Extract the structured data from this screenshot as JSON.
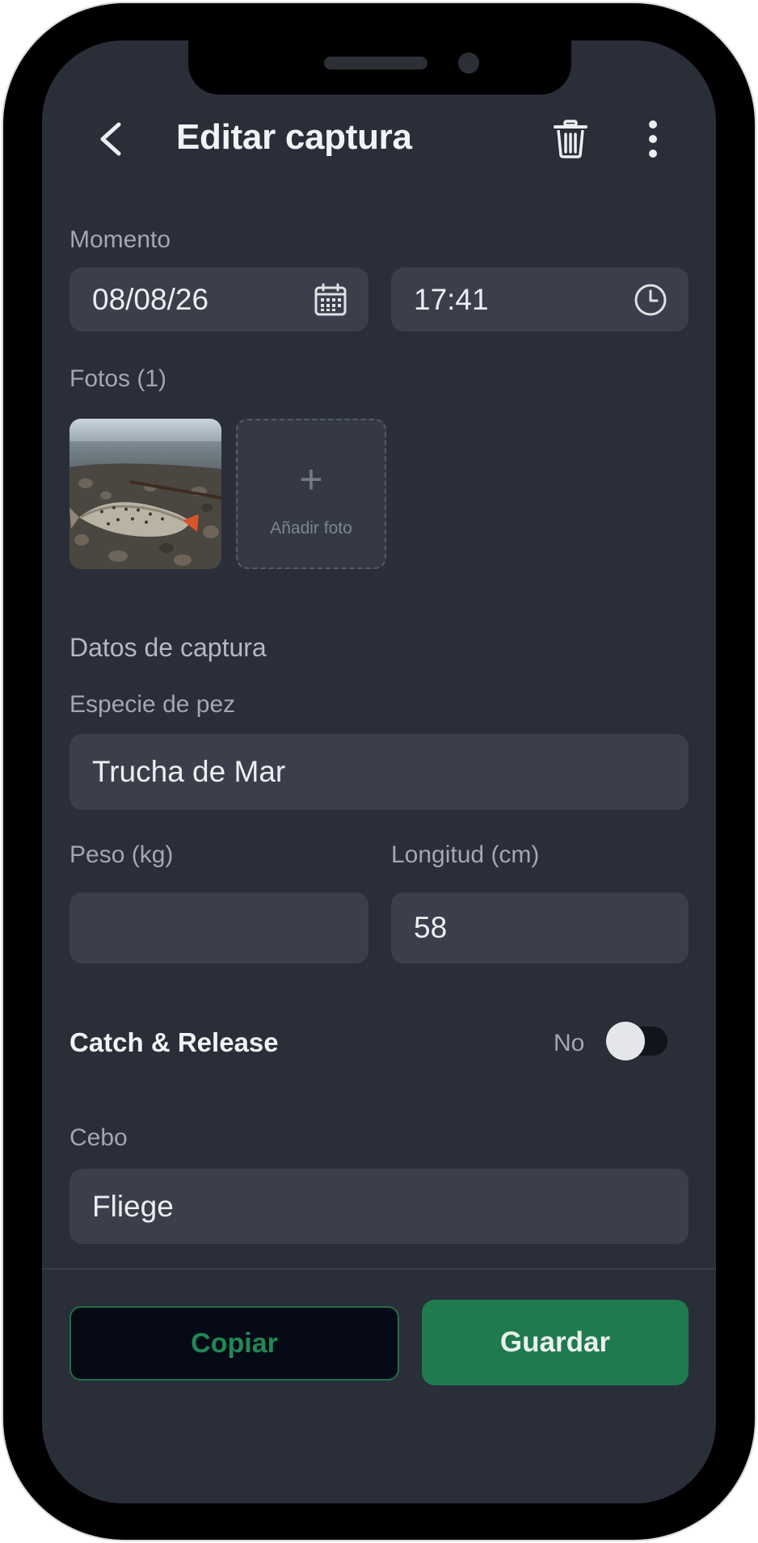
{
  "header": {
    "title": "Editar captura",
    "back_icon": "chevron-left-icon",
    "delete_icon": "trash-icon",
    "more_icon": "more-vertical-icon"
  },
  "moment": {
    "label": "Momento",
    "date": "08/08/26",
    "date_icon": "calendar-icon",
    "time": "17:41",
    "time_icon": "clock-icon"
  },
  "photos": {
    "label": "Fotos (1)",
    "add_label": "Añadir foto",
    "add_symbol": "+"
  },
  "catch_data": {
    "section_title": "Datos de captura",
    "species_label": "Especie de pez",
    "species_value": "Trucha de Mar",
    "weight_label": "Peso (kg)",
    "weight_value": "",
    "length_label": "Longitud (cm)",
    "length_value": "58",
    "catch_release_label": "Catch & Release",
    "catch_release_state": "No",
    "catch_release_on": false,
    "bait_label": "Cebo",
    "bait_value": "Fliege"
  },
  "actions": {
    "copy_label": "Copiar",
    "save_label": "Guardar"
  },
  "colors": {
    "background": "#2a2e39",
    "field": "#3a3f4b",
    "primary": "#1f7a4e",
    "copy_border": "#1f6e45"
  }
}
